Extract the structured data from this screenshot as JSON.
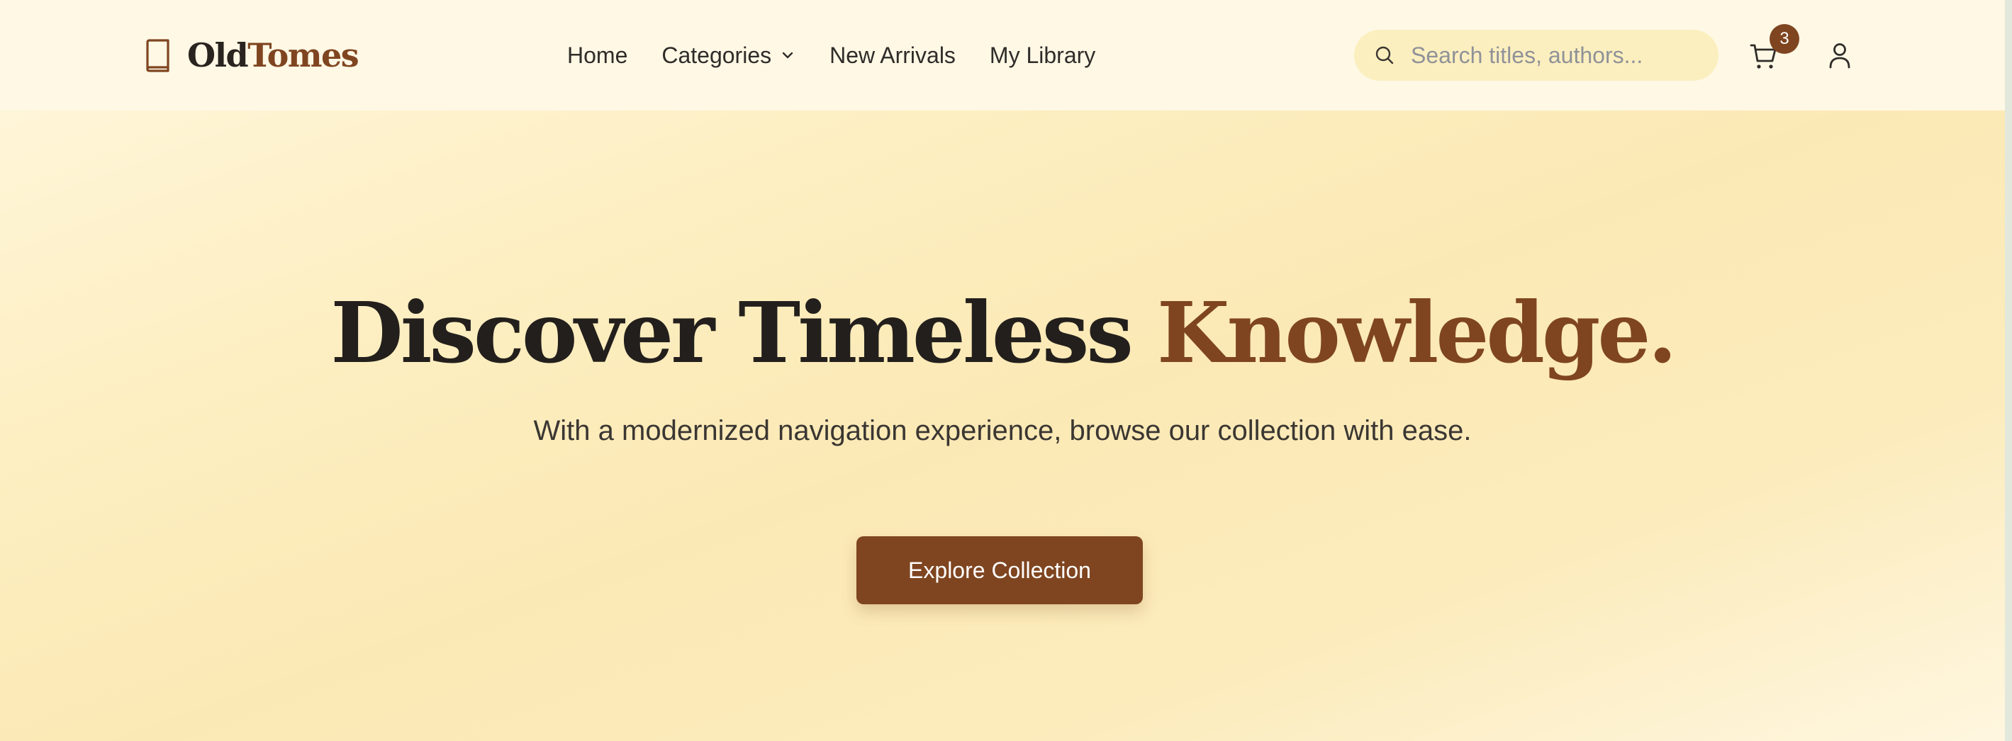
{
  "brand": {
    "icon": "book-icon",
    "name_part1": "Old",
    "name_part2": "Tomes"
  },
  "nav": {
    "links": [
      {
        "label": "Home"
      },
      {
        "label": "Categories",
        "icon": "chevron-down-icon"
      },
      {
        "label": "New Arrivals"
      },
      {
        "label": "My Library"
      }
    ]
  },
  "search": {
    "icon": "search-icon",
    "placeholder": "Search titles, authors...",
    "value": ""
  },
  "cart": {
    "icon": "cart-icon",
    "count": "3"
  },
  "user": {
    "icon": "user-icon"
  },
  "hero": {
    "title_main": "Discover Timeless ",
    "title_accent": "Knowledge.",
    "subtitle": "With a modernized navigation experience, browse our collection with ease.",
    "cta_label": "Explore Collection"
  },
  "colors": {
    "accent": "#7f4520",
    "text_dark": "#231f1c",
    "navbar_bg": "#fef8e5",
    "search_bg": "#fcefbf",
    "hero_bg": "#fbe9b5"
  }
}
